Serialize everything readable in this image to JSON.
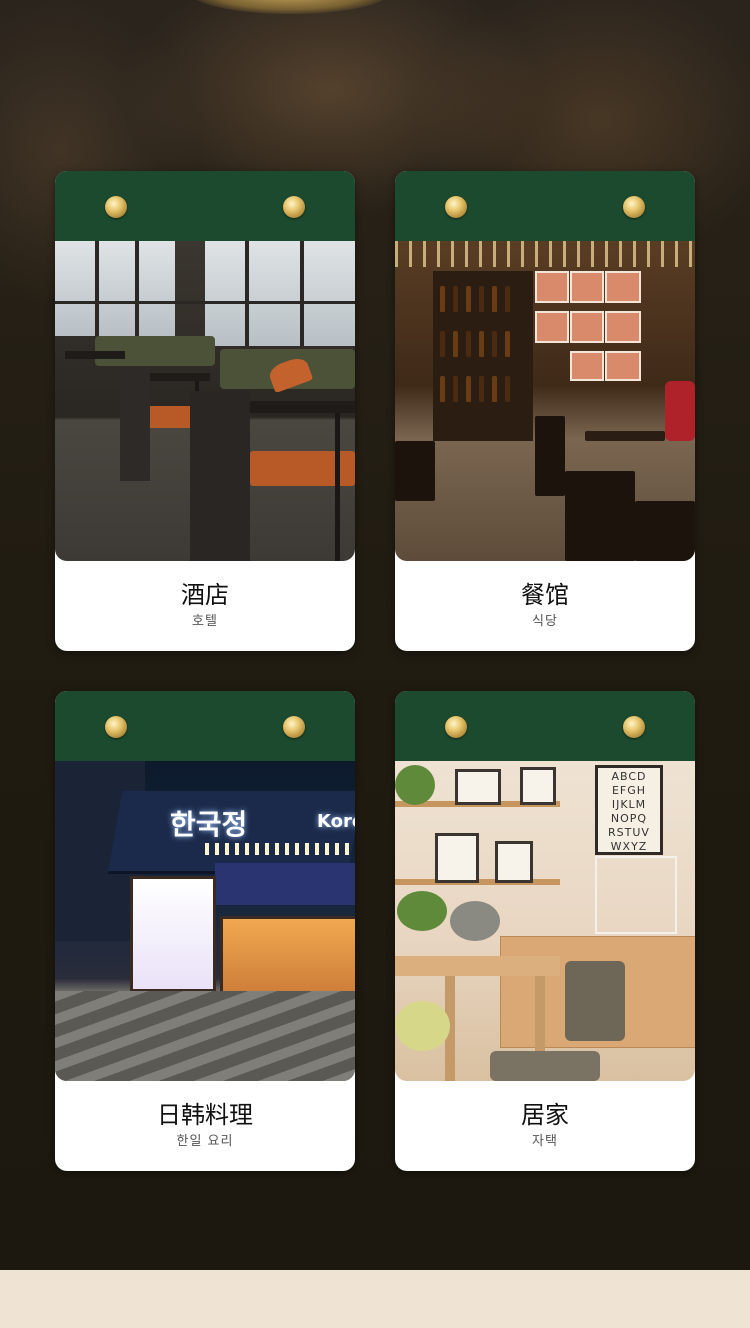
{
  "cards": [
    {
      "title": "酒店",
      "subtitle": "호텔",
      "image": "hotel-interior"
    },
    {
      "title": "餐馆",
      "subtitle": "식당",
      "image": "restaurant-interior"
    },
    {
      "title": "日韩料理",
      "subtitle": "한일 요리",
      "image": "korean-restaurant-storefront"
    },
    {
      "title": "居家",
      "subtitle": "자택",
      "image": "home-dining-room"
    }
  ],
  "scene_text": {
    "korean_sign": "한국정",
    "korean_sign_partial": "Korea",
    "alphabet_poster": [
      "ABCD",
      "EFGH",
      "IJKLM",
      "NOPQ",
      "RSTUV",
      "WXYZ"
    ]
  },
  "colors": {
    "card_header": "#1c4a2f",
    "rivet": "#d4b260",
    "background_dark": "#1e1a10",
    "bottom_band": "#efe3d4"
  }
}
